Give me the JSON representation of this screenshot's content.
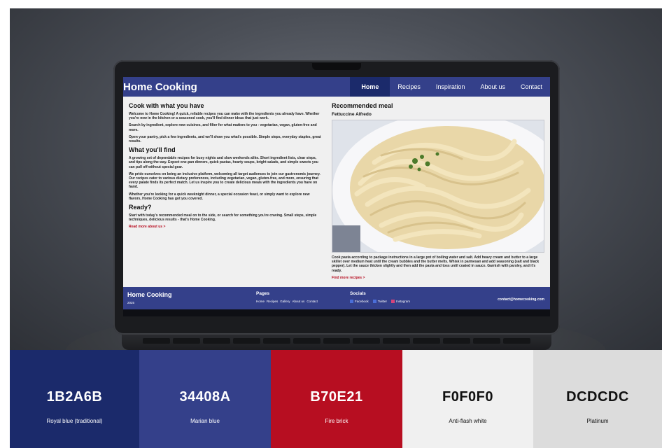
{
  "site": {
    "logo": "Home Cooking",
    "nav": [
      "Home",
      "Recipes",
      "Inspiration",
      "About us",
      "Contact"
    ],
    "left": {
      "h1": "Cook with what you have",
      "p1": "Welcome to Home Cooking! A quick, reliable recipes you can make with the ingredients you already have. Whether you're new in the kitchen or a seasoned cook, you'll find dinner ideas that just work.",
      "p2": "Search by ingredient, explore new cuisines, and filter for what matters to you - vegetarian, vegan, gluten-free and more.",
      "p3": "Open your pantry, pick a few ingredients, and we'll show you what's possible. Simple steps, everyday staples, great results.",
      "h2": "What you'll find",
      "p4": "A growing set of dependable recipes for busy nights and slow weekends alike. Short ingredient lists, clear steps, and tips along the way. Expect one-pan dinners, quick pastas, hearty soups, bright salads, and simple sweets you can pull off without special gear.",
      "p5": "We pride ourselves on being an inclusive platform, welcoming all target audiences to join our gastronomic journey. Our recipes cater to various dietary preferences, including vegetarian, vegan, gluten-free, and more, ensuring that every palate finds its perfect match. Let us inspire you to create delicious meals with the ingredients you have on hand.",
      "p6": "Whether you're looking for a quick weeknight dinner, a special occasion feast, or simply want to explore new flavors, Home Cooking has got you covered.",
      "h3": "Ready?",
      "p7": "Start with today's recommended meal on to the side, or search for something you're craving. Small steps, simple techniques, delicious results - that's Home Cooking.",
      "link": "Read more about us >"
    },
    "right": {
      "heading": "Recommended meal",
      "meal": "Fettuccine Alfredo",
      "desc": "Cook pasta according to package instructions in a large pot of boiling water and salt. Add heavy cream and butter to a large skillet over medium heat until the cream bubbles and the butter melts. Whisk in parmesan and add seasoning (salt and black pepper). Let the sauce thicken slightly and then add the pasta and toss until coated in sauce. Garnish with parsley, and it's ready.",
      "link": "Find more recipes >"
    },
    "footer": {
      "logo": "Home Cooking",
      "year": "2025",
      "pages_heading": "Pages",
      "pages": [
        "Home",
        "Recipes",
        "Gallery",
        "About us",
        "Contact"
      ],
      "socials_heading": "Socials",
      "socials": [
        "Facebook",
        "Twitter",
        "Instagram"
      ],
      "email": "contact@homecooking.com"
    }
  },
  "palette": [
    {
      "hex": "1B2A6B",
      "name": "Royal blue (traditional)",
      "color": "#1B2A6B",
      "text": "#ffffff"
    },
    {
      "hex": "34408A",
      "name": "Marian blue",
      "color": "#34408A",
      "text": "#ffffff"
    },
    {
      "hex": "B70E21",
      "name": "Fire brick",
      "color": "#B70E21",
      "text": "#ffffff"
    },
    {
      "hex": "F0F0F0",
      "name": "Anti-flash white",
      "color": "#F0F0F0",
      "text": "#111111"
    },
    {
      "hex": "DCDCDC",
      "name": "Platinum",
      "color": "#DCDCDC",
      "text": "#111111"
    }
  ]
}
